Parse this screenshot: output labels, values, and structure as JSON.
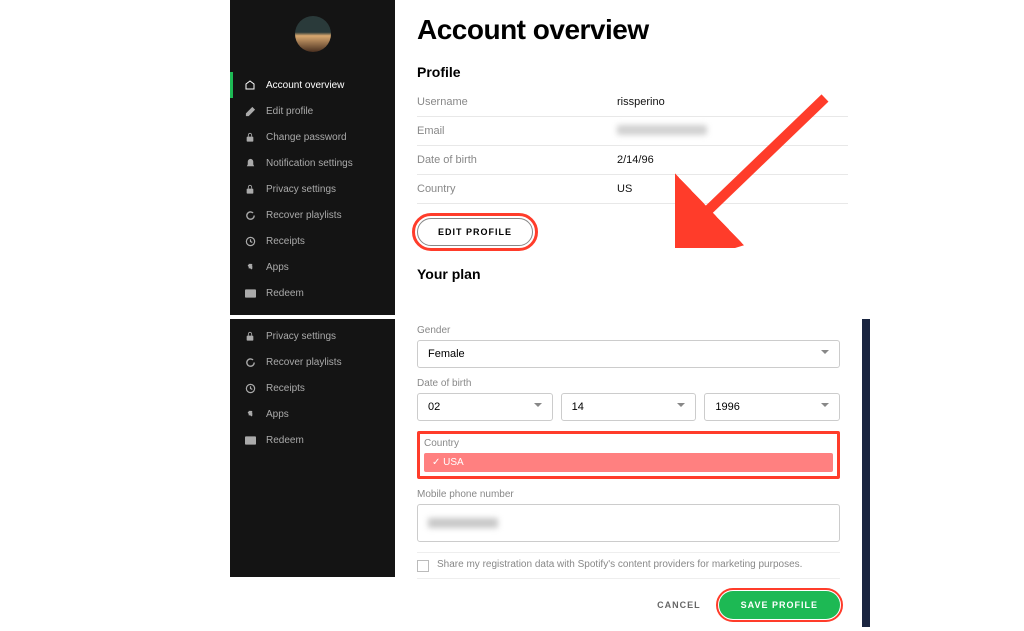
{
  "top": {
    "title": "Account overview",
    "profile_heading": "Profile",
    "plan_heading": "Your plan",
    "nav": [
      {
        "label": "Account overview"
      },
      {
        "label": "Edit profile"
      },
      {
        "label": "Change password"
      },
      {
        "label": "Notification settings"
      },
      {
        "label": "Privacy settings"
      },
      {
        "label": "Recover playlists"
      },
      {
        "label": "Receipts"
      },
      {
        "label": "Apps"
      },
      {
        "label": "Redeem"
      }
    ],
    "profile": {
      "username_lbl": "Username",
      "username": "rissperino",
      "email_lbl": "Email",
      "dob_lbl": "Date of birth",
      "dob": "2/14/96",
      "country_lbl": "Country",
      "country": "US"
    },
    "edit_btn": "EDIT PROFILE"
  },
  "bottom": {
    "nav": [
      {
        "label": "Privacy settings"
      },
      {
        "label": "Recover playlists"
      },
      {
        "label": "Receipts"
      },
      {
        "label": "Apps"
      },
      {
        "label": "Redeem"
      }
    ],
    "form": {
      "gender_lbl": "Gender",
      "gender": "Female",
      "dob_lbl": "Date of birth",
      "day": "02",
      "month": "14",
      "year": "1996",
      "country_lbl": "Country",
      "country": "✓ USA",
      "phone_lbl": "Mobile phone number",
      "consent": "Share my registration data with Spotify's content providers for marketing purposes.",
      "cancel": "CANCEL",
      "save": "SAVE PROFILE"
    }
  }
}
